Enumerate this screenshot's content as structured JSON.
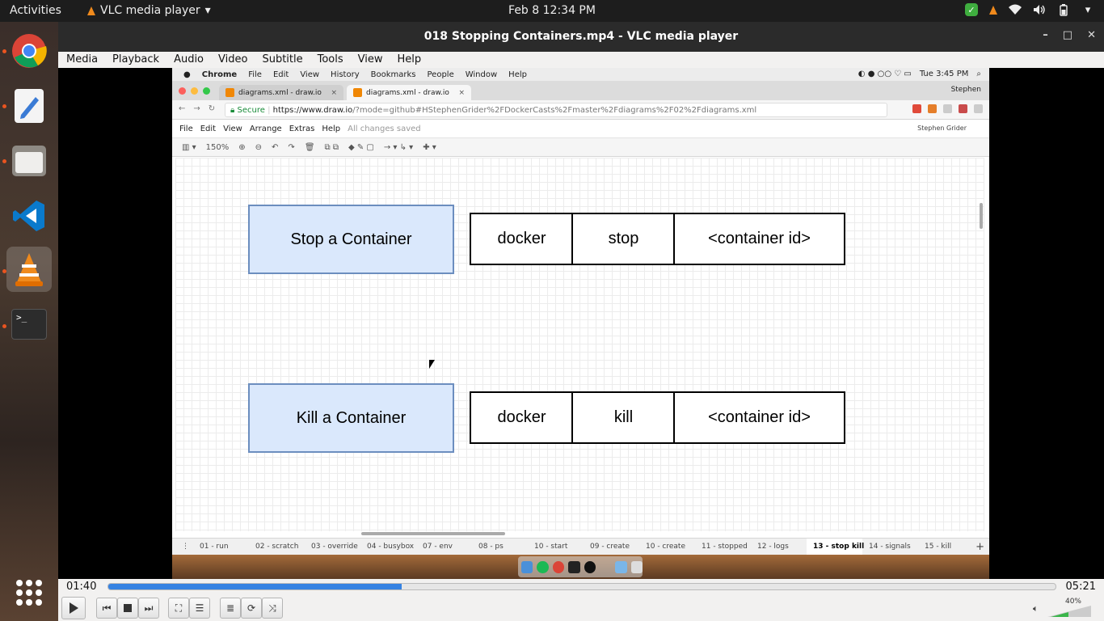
{
  "topbar": {
    "activities": "Activities",
    "app_name": "VLC media player",
    "app_caret": "▾",
    "clock": "Feb 8  12:34 PM",
    "tray_icons": [
      "shield-check-icon",
      "vlc-cone-icon",
      "wifi-icon",
      "volume-icon",
      "battery-icon",
      "caret-down-icon"
    ],
    "caret": "▾"
  },
  "dock": {
    "apps": [
      "chrome-icon",
      "text-editor-icon",
      "files-icon",
      "vscode-icon",
      "vlc-icon",
      "terminal-icon"
    ],
    "terminal_glyph": ">_",
    "show_apps": "show-applications-icon"
  },
  "vlc": {
    "title": "018 Stopping Containers.mp4 - VLC media player",
    "window_buttons": [
      "–",
      "□",
      "✕"
    ],
    "menu": [
      "Media",
      "Playback",
      "Audio",
      "Video",
      "Subtitle",
      "Tools",
      "View",
      "Help"
    ],
    "time_elapsed": "01:40",
    "time_total": "05:21",
    "progress": 0.31,
    "volume_label": "40%",
    "volume": 0.4,
    "accent": "#3582e2"
  },
  "video": {
    "mac_menubar": {
      "apple": "",
      "items": [
        "Chrome",
        "File",
        "Edit",
        "View",
        "History",
        "Bookmarks",
        "People",
        "Window",
        "Help"
      ],
      "clock": "Tue 3:45 PM"
    },
    "chrome": {
      "tabs": [
        {
          "title": "diagrams.xml - draw.io",
          "close": "×"
        },
        {
          "title": "diagrams.xml - draw.io",
          "close": "×"
        }
      ],
      "profile": "Stephen",
      "secure": "Secure",
      "url_host": "https://www.draw.io",
      "url_rest": "/?mode=github#HStephenGrider%2FDockerCasts%2Fmaster%2Fdiagrams%2F02%2Fdiagrams.xml"
    },
    "drawio": {
      "menu": [
        "File",
        "Edit",
        "View",
        "Arrange",
        "Extras",
        "Help"
      ],
      "saved": "All changes saved",
      "user": "Stephen Grider",
      "zoom": "150%",
      "diagram": {
        "stop_label": "Stop a Container",
        "stop_cmd": [
          "docker",
          "stop",
          "<container id>"
        ],
        "kill_label": "Kill a Container",
        "kill_cmd": [
          "docker",
          "kill",
          "<container id>"
        ]
      },
      "pages": [
        "01 - run",
        "02 - scratch",
        "03 - override",
        "04 - busybox",
        "07 - env",
        "08 - ps",
        "10 - start",
        "09 - create",
        "10 - create",
        "11 - stopped",
        "12 - logs",
        "13 - stop kill",
        "14 - signals",
        "15 - kill"
      ],
      "active_page": "13 - stop kill",
      "add_page": "+"
    }
  }
}
